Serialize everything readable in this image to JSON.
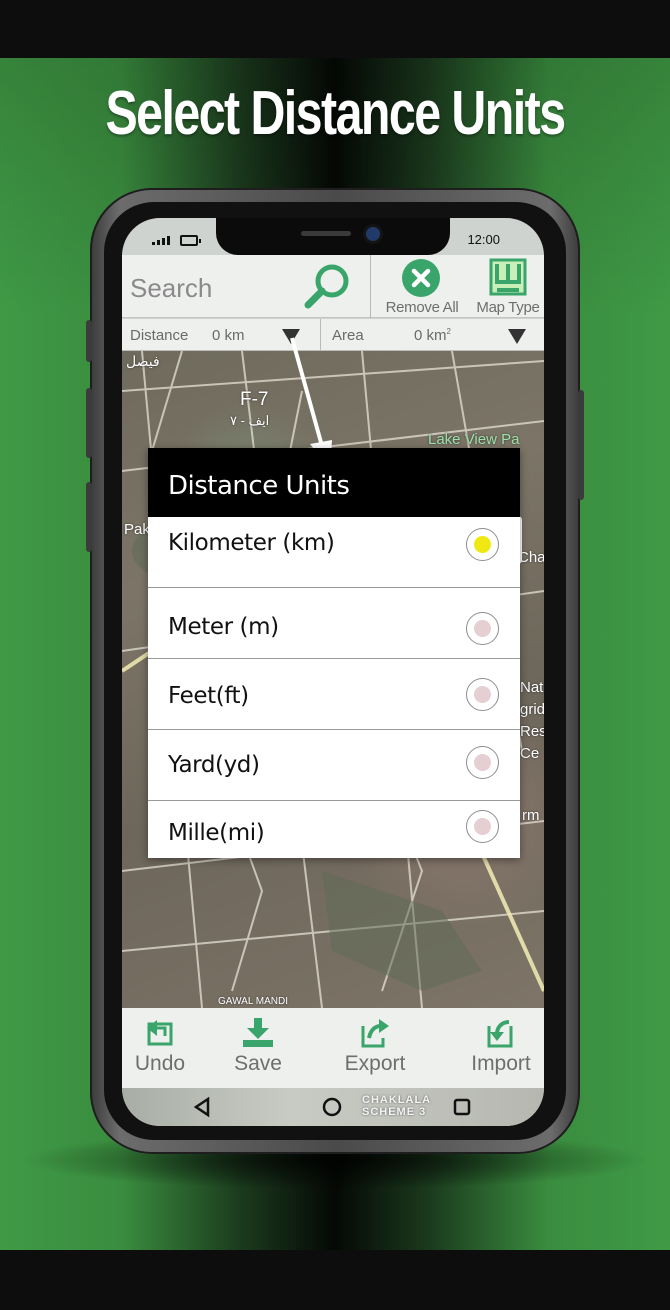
{
  "promo": {
    "headline": "Select Distance Units"
  },
  "status_bar": {
    "time": "12:00"
  },
  "toolbar": {
    "search_placeholder": "Search",
    "remove_all_label": "Remove All",
    "map_type_label": "Map Type"
  },
  "measure_bar": {
    "distance_label": "Distance",
    "distance_value": "0 km",
    "area_label": "Area",
    "area_value": "0 km",
    "area_unit_sup": "2"
  },
  "map": {
    "labels": [
      "فیصل",
      "F-7",
      "ایف - ۷",
      "Lake View Pa",
      "Pak",
      "Cha",
      "Nat",
      "grid",
      "Res",
      "Ce",
      "rm",
      "GAWAL MANDI"
    ]
  },
  "dialog": {
    "title": "Distance Units",
    "options": [
      {
        "label": "Kilometer (km)",
        "selected": true
      },
      {
        "label": "Meter (m)",
        "selected": false
      },
      {
        "label": "Feet(ft)",
        "selected": false
      },
      {
        "label": "Yard(yd)",
        "selected": false
      },
      {
        "label": "Mille(mi)",
        "selected": false
      }
    ]
  },
  "bottom_bar": {
    "undo_label": "Undo",
    "save_label": "Save",
    "export_label": "Export",
    "import_label": "Import"
  },
  "nav_bar": {
    "watermark_line1": "CHAKLALA",
    "watermark_line2": "SCHEME 3"
  },
  "colors": {
    "accent_green": "#3aa56b",
    "selected_radio": "#f0e812",
    "unselected_radio": "#e5cfd2",
    "dialog_title_bg": "#000000"
  }
}
